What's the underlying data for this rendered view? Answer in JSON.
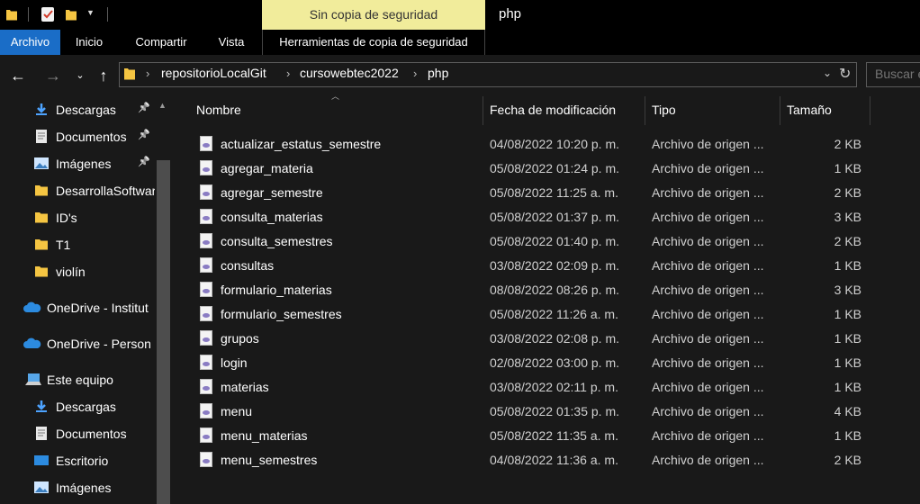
{
  "quick_access_toolbar": {
    "dropdown_icon": "chevron-down-icon"
  },
  "context_tab_group": "Sin copia de seguridad",
  "window_title": "php",
  "ribbon_tabs": [
    "Archivo",
    "Inicio",
    "Compartir",
    "Vista",
    "Herramientas de copia de seguridad"
  ],
  "address": {
    "crumbs": [
      "repositorioLocalGit",
      "cursowebtec2022",
      "php"
    ]
  },
  "search": {
    "placeholder": "Buscar en php"
  },
  "nav_pane": {
    "items": [
      {
        "label": "Descargas",
        "icon": "download-icon",
        "pinned": true
      },
      {
        "label": "Documentos",
        "icon": "document-icon",
        "pinned": true
      },
      {
        "label": "Imágenes",
        "icon": "image-icon",
        "pinned": true
      },
      {
        "label": "DesarrollaSoftware",
        "icon": "folder-icon",
        "pinned": false
      },
      {
        "label": "ID's",
        "icon": "folder-icon",
        "pinned": false
      },
      {
        "label": "T1",
        "icon": "folder-icon",
        "pinned": false
      },
      {
        "label": "violín",
        "icon": "folder-icon",
        "pinned": false
      },
      {
        "label": "OneDrive - Institut",
        "icon": "cloud-icon",
        "pinned": false
      },
      {
        "label": "OneDrive - Person",
        "icon": "cloud-icon",
        "pinned": false
      },
      {
        "label": "Este equipo",
        "icon": "computer-icon",
        "pinned": false
      },
      {
        "label": "Descargas",
        "icon": "download-icon",
        "pinned": false
      },
      {
        "label": "Documentos",
        "icon": "document-icon",
        "pinned": false
      },
      {
        "label": "Escritorio",
        "icon": "desktop-icon",
        "pinned": false
      },
      {
        "label": "Imágenes",
        "icon": "image-icon",
        "pinned": false
      }
    ]
  },
  "columns": {
    "name": "Nombre",
    "date": "Fecha de modificación",
    "type": "Tipo",
    "size": "Tamaño"
  },
  "files": [
    {
      "name": "actualizar_estatus_semestre",
      "date": "04/08/2022 10:20 p. m.",
      "type": "Archivo de origen ...",
      "size": "2 KB"
    },
    {
      "name": "agregar_materia",
      "date": "05/08/2022 01:24 p. m.",
      "type": "Archivo de origen ...",
      "size": "1 KB"
    },
    {
      "name": "agregar_semestre",
      "date": "05/08/2022 11:25 a. m.",
      "type": "Archivo de origen ...",
      "size": "2 KB"
    },
    {
      "name": "consulta_materias",
      "date": "05/08/2022 01:37 p. m.",
      "type": "Archivo de origen ...",
      "size": "3 KB"
    },
    {
      "name": "consulta_semestres",
      "date": "05/08/2022 01:40 p. m.",
      "type": "Archivo de origen ...",
      "size": "2 KB"
    },
    {
      "name": "consultas",
      "date": "03/08/2022 02:09 p. m.",
      "type": "Archivo de origen ...",
      "size": "1 KB"
    },
    {
      "name": "formulario_materias",
      "date": "08/08/2022 08:26 p. m.",
      "type": "Archivo de origen ...",
      "size": "3 KB"
    },
    {
      "name": "formulario_semestres",
      "date": "05/08/2022 11:26 a. m.",
      "type": "Archivo de origen ...",
      "size": "1 KB"
    },
    {
      "name": "grupos",
      "date": "03/08/2022 02:08 p. m.",
      "type": "Archivo de origen ...",
      "size": "1 KB"
    },
    {
      "name": "login",
      "date": "02/08/2022 03:00 p. m.",
      "type": "Archivo de origen ...",
      "size": "1 KB"
    },
    {
      "name": "materias",
      "date": "03/08/2022 02:11 p. m.",
      "type": "Archivo de origen ...",
      "size": "1 KB"
    },
    {
      "name": "menu",
      "date": "05/08/2022 01:35 p. m.",
      "type": "Archivo de origen ...",
      "size": "4 KB"
    },
    {
      "name": "menu_materias",
      "date": "05/08/2022 11:35 a. m.",
      "type": "Archivo de origen ...",
      "size": "1 KB"
    },
    {
      "name": "menu_semestres",
      "date": "04/08/2022 11:36 a. m.",
      "type": "Archivo de origen ...",
      "size": "2 KB"
    }
  ],
  "colors": {
    "accent": "#1a6dc7",
    "context_tab": "#f1ec9b",
    "background": "#191919",
    "folder": "#f5c542"
  }
}
